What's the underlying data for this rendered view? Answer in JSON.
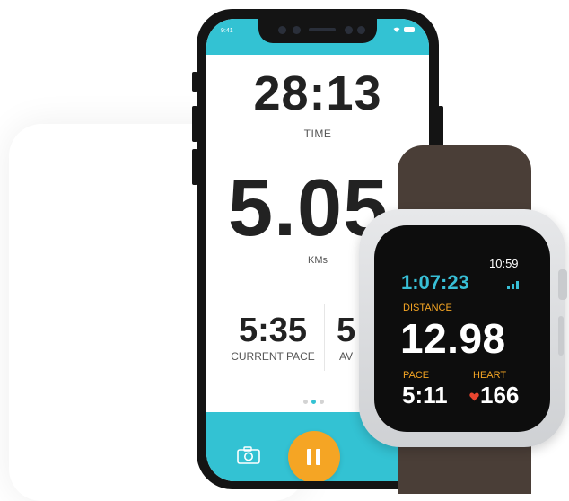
{
  "phone": {
    "status_time": "9:41",
    "time_value": "28:13",
    "time_label": "TIME",
    "distance_value": "5.05",
    "distance_label": "KMs",
    "pace_value": "5:35",
    "pace_label": "CURRENT PACE",
    "avg_value": "5",
    "avg_label": "AV",
    "page_dots": 3,
    "active_dot": 1,
    "icons": [
      "wifi-icon",
      "battery-icon",
      "camera-icon",
      "pause-icon"
    ]
  },
  "watch": {
    "clock": "10:59",
    "timer": "1:07:23",
    "distance_label": "DISTANCE",
    "distance_value": "12.98",
    "pace_label": "PACE",
    "pace_value": "5:11",
    "heart_label": "HEART",
    "heart_value": "166",
    "icons": [
      "signal-icon",
      "heart-icon"
    ]
  },
  "colors": {
    "accent": "#33c2d3",
    "orange": "#f5a524",
    "text_dark": "#222222",
    "band": "#4a3e37",
    "heart": "#e8452f"
  }
}
